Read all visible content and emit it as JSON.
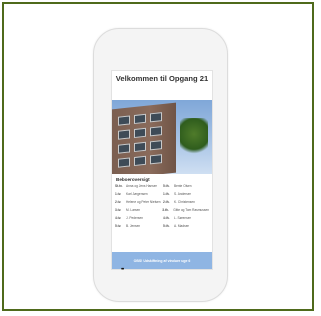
{
  "device": {
    "screen": {
      "title": "Velkommen til Opgang 21",
      "photo_desc": "building-photo",
      "section_title": "Beboeroversigt",
      "residents": [
        {
          "unit": "St.tv.",
          "name": "Anna og Jens Hansen",
          "unit2": "5.th.",
          "name2": "Bente Olsen"
        },
        {
          "unit": "1.tv.",
          "name": "Karl Jørgensen",
          "unit2": "1.th.",
          "name2": "S. Andersen"
        },
        {
          "unit": "2.tv.",
          "name": "Helene og Peter Nielsen",
          "unit2": "2.th.",
          "name2": "K. Christensen"
        },
        {
          "unit": "3.tv.",
          "name": "M. Larsen",
          "unit2": "3.th.",
          "name2": "Gitte og Tom Rasmussen"
        },
        {
          "unit": "4.tv.",
          "name": "J. Pedersen",
          "unit2": "4.th.",
          "name2": "L. Sørensen"
        },
        {
          "unit": "5.tv.",
          "name": "B. Jensen",
          "unit2": "5.th.",
          "name2": "A. Madsen"
        }
      ],
      "info_bar": "OBS! Udskiftning af vinduer uge 6"
    },
    "home_indicator": "••"
  }
}
